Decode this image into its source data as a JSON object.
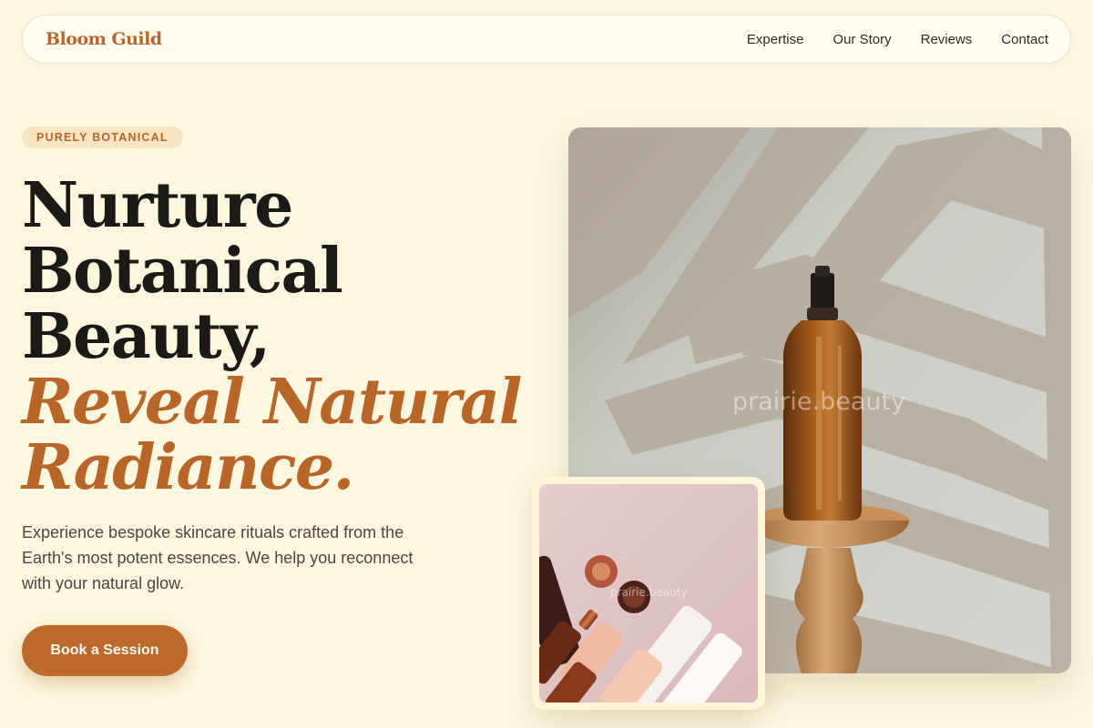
{
  "nav": {
    "brand": "Bloom Guild",
    "links": [
      "Expertise",
      "Our Story",
      "Reviews",
      "Contact"
    ]
  },
  "hero": {
    "badge": "PURELY BOTANICAL",
    "headline": [
      "Nurture",
      "Botanical",
      "Beauty,"
    ],
    "headline_accent": [
      "Reveal Natural",
      "Radiance."
    ],
    "lead": "Experience bespoke skincare rituals crafted from the Earth's most potent essences. We help you reconnect with your natural glow.",
    "cta": "Book a Session"
  },
  "images": {
    "main_watermark": "prairie.beauty",
    "small_watermark": "prairie.beauty"
  },
  "colors": {
    "background": "#fdf7df",
    "accent": "#b8652a",
    "badge_bg": "#f7e4c2",
    "text": "#1c1a17"
  }
}
